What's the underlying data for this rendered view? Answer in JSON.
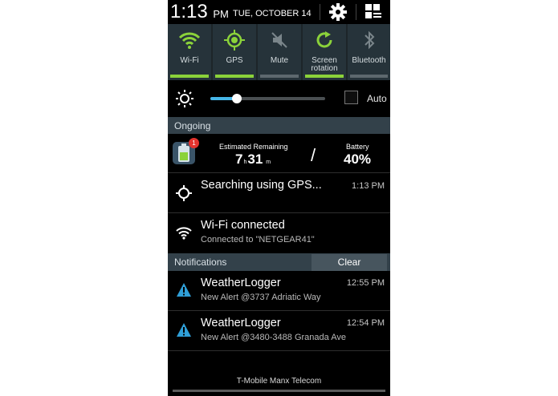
{
  "status_bar": {
    "time": "1:13",
    "ampm": "PM",
    "date": "TUE, OCTOBER 14"
  },
  "quick_toggles": [
    {
      "label": "Wi-Fi",
      "icon": "wifi-icon",
      "on": true
    },
    {
      "label": "GPS",
      "icon": "gps-icon",
      "on": true
    },
    {
      "label": "Mute",
      "icon": "mute-icon",
      "on": false
    },
    {
      "label": "Screen rotation",
      "icon": "rotation-icon",
      "on": true
    },
    {
      "label": "Bluetooth",
      "icon": "bluetooth-icon",
      "on": false
    }
  ],
  "brightness": {
    "level": 0.23,
    "auto_label": "Auto",
    "auto_checked": false
  },
  "ongoing": {
    "header": "Ongoing",
    "battery": {
      "badge": "1",
      "estimated_label": "Estimated Remaining",
      "hours": "7",
      "hours_unit": "h",
      "minutes": "31",
      "minutes_unit": "m",
      "separator": "/",
      "battery_label": "Battery",
      "battery_value": "40%"
    },
    "gps": {
      "title": "Searching using GPS...",
      "time": "1:13 PM"
    },
    "wifi": {
      "title": "Wi-Fi connected",
      "subtitle": "Connected to \"NETGEAR41\""
    }
  },
  "notifications": {
    "header": "Notifications",
    "clear_label": "Clear",
    "items": [
      {
        "title": "WeatherLogger",
        "subtitle": "New Alert @3737 Adriatic Way",
        "time": "12:55 PM"
      },
      {
        "title": "WeatherLogger",
        "subtitle": "New Alert @3480-3488 Granada Ave",
        "time": "12:54 PM"
      }
    ]
  },
  "carrier": "T-Mobile Manx Telecom",
  "colors": {
    "toggle_on": "#8bd23a",
    "toggle_off": "#5d686e",
    "slider": "#46b6e8",
    "alert": "#2f9fd8",
    "badge": "#e3332e"
  }
}
